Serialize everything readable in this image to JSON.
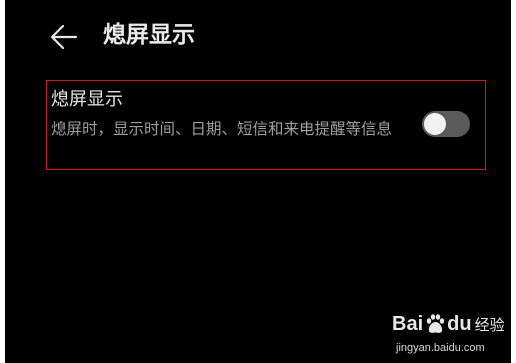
{
  "header": {
    "title": "熄屏显示",
    "back_icon": "arrow-left-icon"
  },
  "setting": {
    "title": "熄屏显示",
    "description": "熄屏时，显示时间、日期、短信和来电提醒等信息",
    "toggle_state": "off"
  },
  "colors": {
    "background": "#000000",
    "highlight_border": "#d0161f",
    "toggle_track": "#5a5a5a",
    "toggle_knob": "#f2f2f2"
  },
  "watermark": {
    "logo_prefix": "Bai",
    "logo_suffix": "du",
    "logo_product": "经验",
    "url": "jingyan.baidu.com",
    "paw_icon": "baidu-paw-icon"
  }
}
